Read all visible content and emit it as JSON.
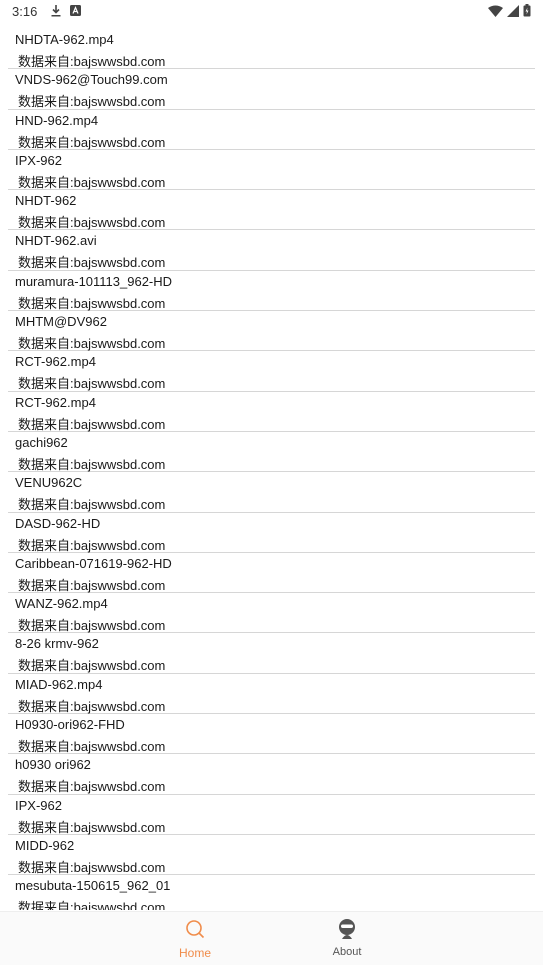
{
  "status_bar": {
    "time": "3:16",
    "left_icons": [
      "download-icon",
      "a-badge-icon"
    ],
    "right_icons": [
      "wifi-icon",
      "signal-icon",
      "battery-icon"
    ]
  },
  "list": {
    "items": [
      {
        "title": "NHDTA-962.mp4",
        "source": "数据来自:bajswwsbd.com"
      },
      {
        "title": "VNDS-962@Touch99.com",
        "source": "数据来自:bajswwsbd.com"
      },
      {
        "title": "HND-962.mp4",
        "source": "数据来自:bajswwsbd.com"
      },
      {
        "title": "IPX-962",
        "source": "数据来自:bajswwsbd.com"
      },
      {
        "title": "NHDT-962",
        "source": "数据来自:bajswwsbd.com"
      },
      {
        "title": "NHDT-962.avi",
        "source": "数据来自:bajswwsbd.com"
      },
      {
        "title": "muramura-101113_962-HD",
        "source": "数据来自:bajswwsbd.com"
      },
      {
        "title": "MHTM@DV962",
        "source": "数据来自:bajswwsbd.com"
      },
      {
        "title": "RCT-962.mp4",
        "source": "数据来自:bajswwsbd.com"
      },
      {
        "title": "RCT-962.mp4",
        "source": "数据来自:bajswwsbd.com"
      },
      {
        "title": "gachi962",
        "source": "数据来自:bajswwsbd.com"
      },
      {
        "title": "VENU962C",
        "source": "数据来自:bajswwsbd.com"
      },
      {
        "title": "DASD-962-HD",
        "source": "数据来自:bajswwsbd.com"
      },
      {
        "title": "Caribbean-071619-962-HD",
        "source": "数据来自:bajswwsbd.com"
      },
      {
        "title": "WANZ-962.mp4",
        "source": "数据来自:bajswwsbd.com"
      },
      {
        "title": "8-26 krmv-962",
        "source": "数据来自:bajswwsbd.com"
      },
      {
        "title": "MIAD-962.mp4",
        "source": "数据来自:bajswwsbd.com"
      },
      {
        "title": "H0930-ori962-FHD",
        "source": "数据来自:bajswwsbd.com"
      },
      {
        "title": "h0930 ori962",
        "source": "数据来自:bajswwsbd.com"
      },
      {
        "title": "IPX-962",
        "source": "数据来自:bajswwsbd.com"
      },
      {
        "title": "MIDD-962",
        "source": "数据来自:bajswwsbd.com"
      },
      {
        "title": "mesubuta-150615_962_01",
        "source": "数据来自:bajswwsbd.com"
      }
    ]
  },
  "bottom_nav": {
    "home": {
      "label": "Home",
      "icon": "search-icon",
      "color": "#f08c4a"
    },
    "about": {
      "label": "About",
      "icon": "profile-icon",
      "color": "#555555"
    }
  }
}
